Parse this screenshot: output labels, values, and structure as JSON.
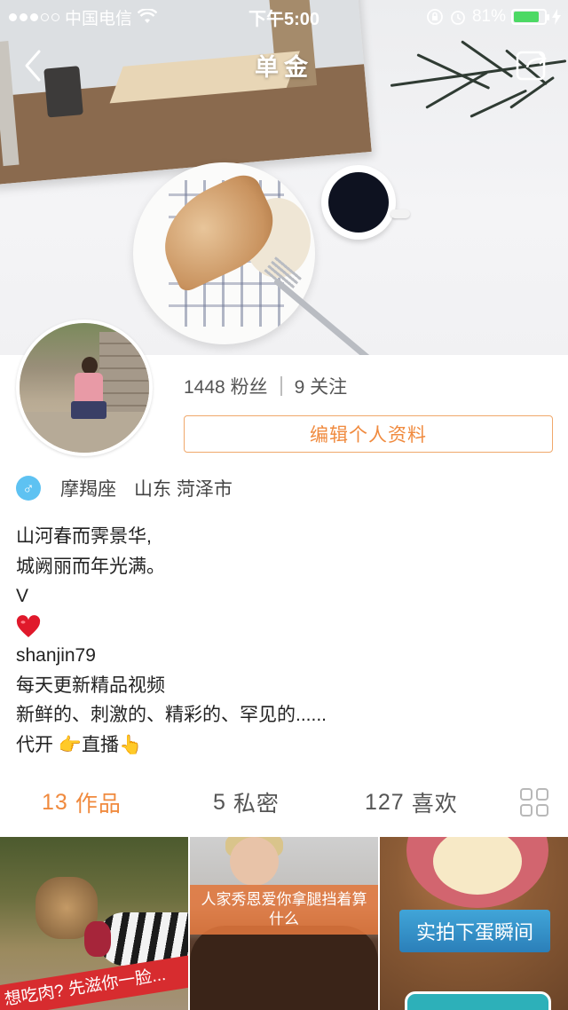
{
  "status_bar": {
    "carrier": "中国电信",
    "time": "下午5:00",
    "battery_percent": "81%",
    "battery_level": 0.81
  },
  "nav": {
    "title": "单金",
    "back_icon": "chevron-left-icon",
    "share_icon": "share-icon"
  },
  "profile": {
    "followers_count": "1448",
    "followers_label": "粉丝",
    "following_count": "9",
    "following_label": "关注",
    "edit_button_label": "编辑个人资料",
    "gender_symbol": "♂",
    "zodiac": "摩羯座",
    "location": "山东 菏泽市",
    "bio_lines": [
      "山河春而霁景华,",
      "城阙丽而年光满。",
      "V",
      "",
      "shanjin79",
      "每天更新精品视频",
      "新鲜的、刺激的、精彩的、罕见的......",
      "代开 👉直播👆"
    ]
  },
  "tabs": [
    {
      "count": "13",
      "label": "作品",
      "active": true
    },
    {
      "count": "5",
      "label": "私密",
      "active": false
    },
    {
      "count": "127",
      "label": "喜欢",
      "active": false
    }
  ],
  "thumbnails": [
    {
      "caption": "想吃肉? 先滋你一脸..."
    },
    {
      "caption": "人家秀恩爱你拿腿挡着算什么"
    },
    {
      "caption": "实拍下蛋瞬间"
    }
  ],
  "colors": {
    "accent": "#f08a3e",
    "gender_blue": "#5ec2f2",
    "battery_green": "#4cd964",
    "heart_red": "#e0192b"
  }
}
